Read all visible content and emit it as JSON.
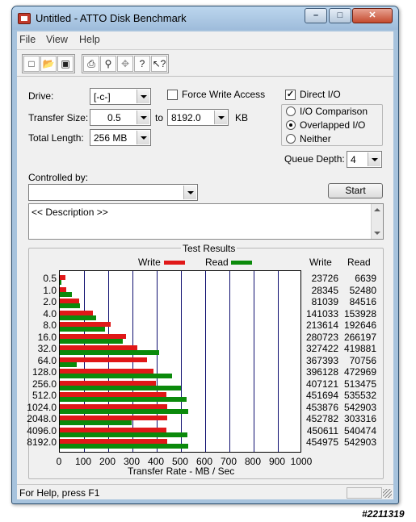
{
  "window": {
    "title": "Untitled - ATTO Disk Benchmark"
  },
  "menu": [
    "File",
    "View",
    "Help"
  ],
  "toolbar": {
    "icons": [
      "new-file-icon",
      "open-folder-icon",
      "save-icon",
      "print-icon",
      "print-preview-icon",
      "move-icon",
      "help-icon",
      "context-help-icon"
    ]
  },
  "drive": {
    "label": "Drive:",
    "value": "[-c-]"
  },
  "force_write": {
    "label": "Force Write Access",
    "checked": false
  },
  "direct_io": {
    "label": "Direct I/O",
    "checked": true
  },
  "transfer": {
    "label": "Transfer Size:",
    "from": "0.5",
    "to_word": "to",
    "to": "8192.0",
    "unit": "KB"
  },
  "total_length": {
    "label": "Total Length:",
    "value": "256 MB"
  },
  "io_mode": {
    "options": [
      "I/O Comparison",
      "Overlapped I/O",
      "Neither"
    ],
    "selected": "Overlapped I/O"
  },
  "queue_depth": {
    "label": "Queue Depth:",
    "value": "4"
  },
  "controlled_by": {
    "label": "Controlled by:",
    "value": ""
  },
  "start_button": "Start",
  "description": "<< Description >>",
  "results": {
    "title": "Test Results",
    "write_label": "Write",
    "read_label": "Read",
    "write_col": "Write",
    "read_col": "Read",
    "write_color": "#e01818",
    "read_color": "#0b8a0b",
    "axis_title": "Transfer Rate - MB / Sec"
  },
  "chart_data": {
    "type": "bar",
    "orientation": "horizontal",
    "xlabel": "Transfer Rate - MB / Sec",
    "xlim": [
      0,
      1000
    ],
    "xticks": [
      "0",
      "100",
      "200",
      "300",
      "400",
      "500",
      "600",
      "700",
      "800",
      "900",
      "1000"
    ],
    "grid": true,
    "legend_position": "top",
    "categories": [
      "0.5",
      "1.0",
      "2.0",
      "4.0",
      "8.0",
      "16.0",
      "32.0",
      "64.0",
      "128.0",
      "256.0",
      "512.0",
      "1024.0",
      "2048.0",
      "4096.0",
      "8192.0"
    ],
    "series": [
      {
        "name": "Write",
        "values": [
          23726,
          28345,
          81039,
          141033,
          213614,
          280723,
          327422,
          367393,
          396128,
          407121,
          451694,
          453876,
          452782,
          450611,
          454975
        ],
        "display": [
          "23726",
          "28345",
          "81039",
          "141033",
          "213614",
          "280723",
          "327422",
          "367393",
          "396128",
          "407121",
          "451694",
          "453876",
          "452782",
          "450611",
          "454975"
        ]
      },
      {
        "name": "Read",
        "values": [
          6639,
          52480,
          84516,
          153928,
          192646,
          266197,
          419881,
          70756,
          472969,
          513475,
          535532,
          542903,
          303316,
          540474,
          542903
        ],
        "display": [
          "6639",
          "52480",
          "84516",
          "153928",
          "192646",
          "266197",
          "419881",
          "70756",
          "472969",
          "513475",
          "535532",
          "542903",
          "303316",
          "540474",
          "542903"
        ]
      }
    ]
  },
  "status": {
    "text": "For Help, press F1"
  },
  "watermark": "#2211319"
}
